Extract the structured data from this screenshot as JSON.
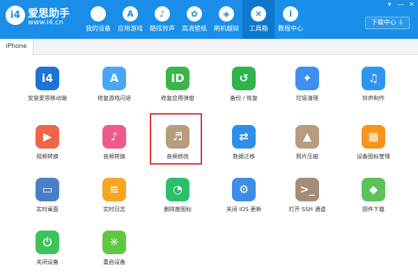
{
  "brand": {
    "logo_text": "i4",
    "name": "爱思助手",
    "url": "www.i4.cn"
  },
  "window_controls": [
    "▾",
    "—",
    "✕"
  ],
  "nav": [
    {
      "label": "我的设备",
      "icon": "apple-icon",
      "glyph": ""
    },
    {
      "label": "应用游戏",
      "icon": "app-store-icon",
      "glyph": "A"
    },
    {
      "label": "酷炫铃声",
      "icon": "bell-icon",
      "glyph": "♪"
    },
    {
      "label": "高清壁纸",
      "icon": "flower-icon",
      "glyph": "✿"
    },
    {
      "label": "刷机越狱",
      "icon": "box-icon",
      "glyph": "◈"
    },
    {
      "label": "工具箱",
      "icon": "tools-icon",
      "glyph": "✕",
      "active": true
    },
    {
      "label": "教程中心",
      "icon": "info-icon",
      "glyph": "i"
    }
  ],
  "download_button": {
    "label": "下载中心 ⇩"
  },
  "tab": {
    "label": "iPhone"
  },
  "tools": [
    {
      "label": "安装爱思移动端",
      "icon": "i4-app-icon",
      "glyph": "i4",
      "color": "#1d73d6"
    },
    {
      "label": "修复游戏闪退",
      "icon": "app-store-repair-icon",
      "glyph": "A",
      "color": "#4aa6f5"
    },
    {
      "label": "修复应用弹窗",
      "icon": "apple-id-icon",
      "glyph": "ID",
      "color": "#3bb54a"
    },
    {
      "label": "备份 / 恢复",
      "icon": "backup-restore-icon",
      "glyph": "↺",
      "color": "#2fb34a"
    },
    {
      "label": "垃圾清理",
      "icon": "broom-icon",
      "glyph": "✦",
      "color": "#3f8ff0"
    },
    {
      "label": "铃声制作",
      "icon": "bell-plus-icon",
      "glyph": "♫",
      "color": "#2f95ef"
    },
    {
      "label": "视频转换",
      "icon": "video-play-icon",
      "glyph": "▶",
      "color": "#f0644a"
    },
    {
      "label": "音频转换",
      "icon": "music-note-icon",
      "glyph": "♪",
      "color": "#ee5a8a"
    },
    {
      "label": "音频修改",
      "icon": "audio-edit-icon",
      "glyph": "♬",
      "color": "#b89c7e"
    },
    {
      "label": "数据迁移",
      "icon": "data-transfer-icon",
      "glyph": "⇄",
      "color": "#2f8fe8"
    },
    {
      "label": "照片压缩",
      "icon": "photo-icon",
      "glyph": "▲",
      "color": "#b89c7e"
    },
    {
      "label": "设备图标管理",
      "icon": "icon-grid-icon",
      "glyph": "▦",
      "color": "#f5951e"
    },
    {
      "label": "实时桌面",
      "icon": "monitor-icon",
      "glyph": "▭",
      "color": "#4a7fc8"
    },
    {
      "label": "实时日志",
      "icon": "log-file-icon",
      "glyph": "≡",
      "color": "#f5a623"
    },
    {
      "label": "删除废图标",
      "icon": "pie-chart-icon",
      "glyph": "◔",
      "color": "#2cbf6a"
    },
    {
      "label": "关闭 iOS 更新",
      "icon": "gear-update-icon",
      "glyph": "⚙",
      "color": "#3d8de6"
    },
    {
      "label": "打开 SSH 通道",
      "icon": "terminal-icon",
      "glyph": ">_",
      "color": "#a48e78"
    },
    {
      "label": "固件下载",
      "icon": "cube-icon",
      "glyph": "◆",
      "color": "#5cc25b"
    },
    {
      "label": "关闭设备",
      "icon": "power-icon",
      "glyph": "⏻",
      "color": "#3cc45a"
    },
    {
      "label": "重启设备",
      "icon": "restart-icon",
      "glyph": "✳",
      "color": "#5fc840"
    }
  ]
}
